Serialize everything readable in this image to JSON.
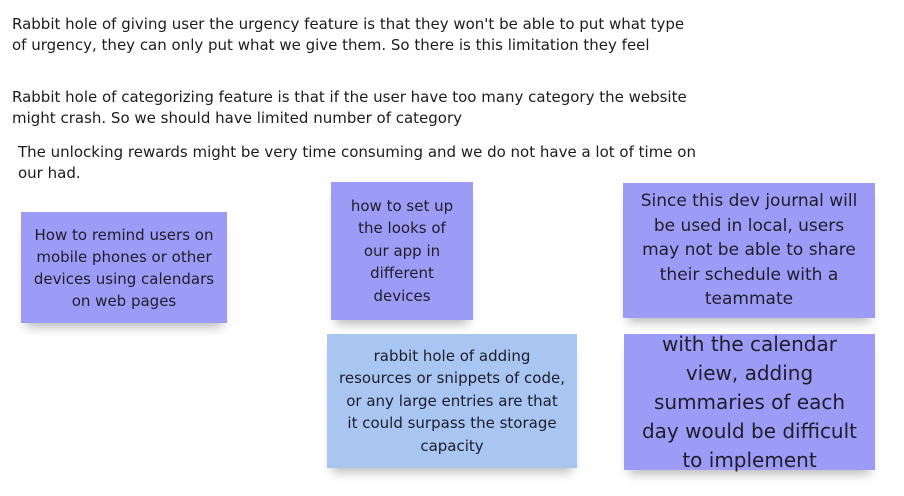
{
  "text_blocks": [
    "Rabbit hole of giving user the urgency feature is that they won't be able to put what type of urgency, they can only put what we give them. So there is this limitation they feel",
    "Rabbit hole of categorizing feature is that if the user have too many category the website might crash. So we should have limited number of category",
    "The unlocking rewards might be very time consuming and we do not have a lot of time on our had."
  ],
  "sticky_notes": [
    {
      "text": "How to remind users on mobile phones or other devices using calendars on web pages",
      "color": "#9c9cf7"
    },
    {
      "text": "how to set up the looks of our app in different devices",
      "color": "#9c9cf7"
    },
    {
      "text": "Since this dev journal will be used in local, users may not be able to share their schedule with a teammate",
      "color": "#9c9cf7"
    },
    {
      "text": "rabbit hole of adding resources or snippets of code, or any large entries are that it could surpass the storage capacity",
      "color": "#a9c6f2"
    },
    {
      "text": "with the calendar view, adding summaries of each day would be difficult to implement",
      "color": "#9c9cf7"
    }
  ]
}
